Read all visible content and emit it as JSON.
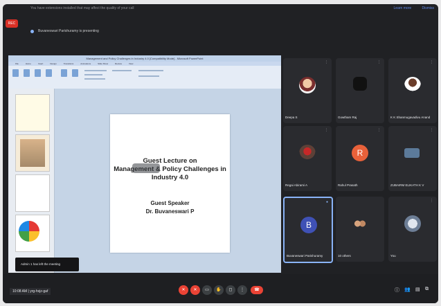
{
  "topbar": {
    "message": "You have extensions installed that may affect the quality of your call",
    "link1": "Learn more",
    "link2": "Dismiss"
  },
  "rec_label": "REC",
  "presenting": "Buvaneswari Parishuramy is presenting",
  "powerpoint": {
    "window_title": "Management and Policy Challenges in Industry 4.0 [Compatibility Mode] - Microsoft PowerPoint",
    "tabs": [
      "File",
      "Home",
      "Insert",
      "Design",
      "Transitions",
      "Animations",
      "Slide Show",
      "Review",
      "View"
    ],
    "slide": {
      "title_lines": [
        "Guest Lecture on",
        "Management & Policy Challenges in",
        "Industry 4.0"
      ],
      "speaker_lines": [
        "Guest Speaker",
        "Dr. Buvaneswari P"
      ]
    }
  },
  "participants": [
    {
      "name": "Deepa S"
    },
    {
      "name": "Gowtham Raj"
    },
    {
      "name": "K K Shanmugavadivu Anand"
    },
    {
      "name": "Regai Abirami A"
    },
    {
      "name": "Rahul Prasath"
    },
    {
      "name": "ZUBAIRM ELIKATH K V"
    },
    {
      "name": "Buvaneswari Parishuramy"
    },
    {
      "name": "10 others"
    },
    {
      "name": "You"
    }
  ],
  "toast": "Admin 1 has left the meeting",
  "meeting": {
    "time": "10:08 AM",
    "code": "yrg-hxjz-gaf"
  }
}
